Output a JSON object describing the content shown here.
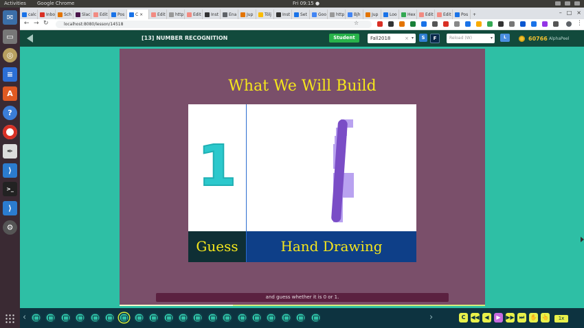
{
  "os": {
    "app_name": "Activities",
    "browser_name": "Google Chrome",
    "clock": "Fri 09:15 ●"
  },
  "browser": {
    "tabs": [
      "calc",
      "Inbo",
      "Sch",
      "Slac",
      "Edit",
      "Pos",
      "C ×",
      "Edit",
      "http",
      "Edit",
      "Inst",
      "Ena",
      "Jup",
      "Tölj",
      "Inst",
      "Set",
      "Goo",
      "http",
      "Bjh",
      "Jup",
      "Loo",
      "Hex",
      "Edit",
      "Edit",
      "Pos"
    ],
    "active_tab_index": 6,
    "url": "localhost:8080/lesson/14518"
  },
  "app": {
    "lesson_title": "[13] NUMBER RECOGNITION",
    "student_label": "Student",
    "term_value": "Fall2018",
    "s_label": "S",
    "f_label": "F",
    "reload_placeholder": "Reload (W)",
    "l_label": "L",
    "coins": "60766",
    "user_label": "AlphaPeel",
    "colors": {
      "accent_green": "#28b34a",
      "coin": "#f2c230",
      "heading_yellow": "#f5e61c"
    }
  },
  "slide": {
    "heading": "What We Will Build",
    "digit": "1",
    "guess_label": "Guess",
    "hand_label": "Hand Drawing",
    "caption": "and guess whether it is 0 or 1.",
    "progress": 0.31
  },
  "player": {
    "speed": "1x",
    "thumb_count": 20,
    "selected_thumb_index": 6,
    "controls": [
      "C",
      "◀◀",
      "◀",
      "▶",
      "▶▶",
      "⏭",
      "✋",
      "👆"
    ]
  }
}
